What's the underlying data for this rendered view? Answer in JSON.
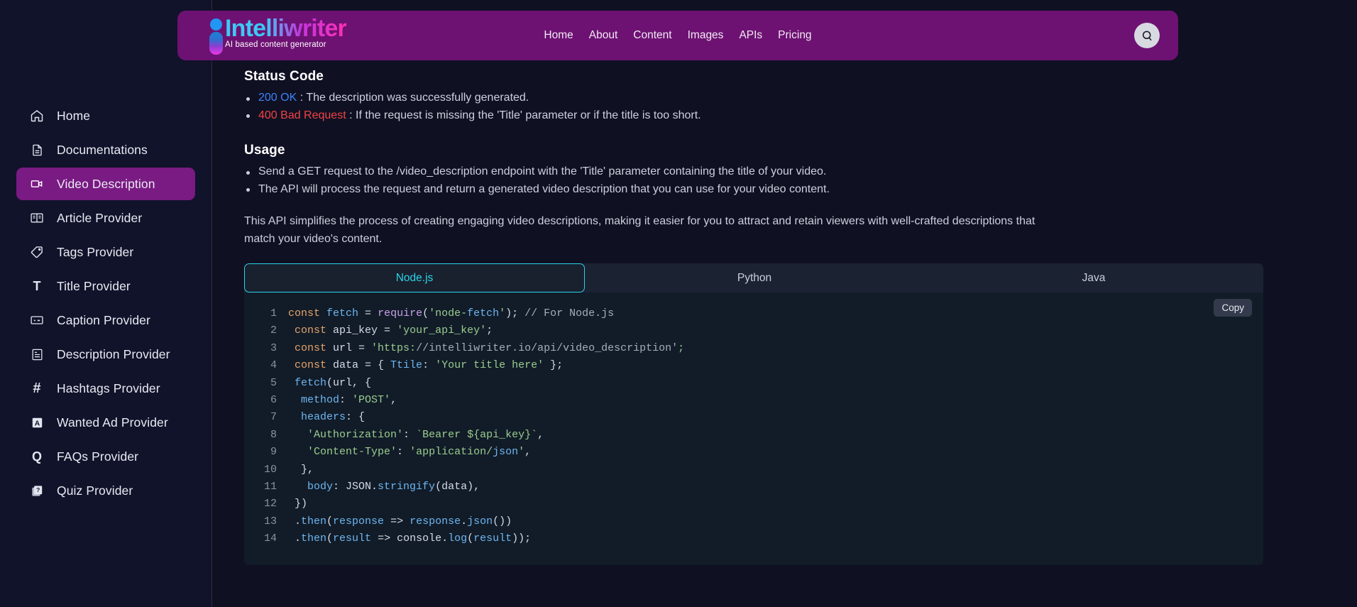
{
  "header": {
    "logo": {
      "word": "Intelliwriter",
      "tagline": "AI based content generator"
    },
    "nav": [
      "Home",
      "About",
      "Content",
      "Images",
      "APIs",
      "Pricing"
    ],
    "search_icon": "search-icon",
    "bg_color": "#6d1272"
  },
  "sidebar": {
    "items": [
      {
        "label": "Home",
        "icon": "home-icon",
        "active": false
      },
      {
        "label": "Documentations",
        "icon": "document-icon",
        "active": false
      },
      {
        "label": "Video Description",
        "icon": "video-icon",
        "active": true
      },
      {
        "label": "Article Provider",
        "icon": "book-icon",
        "active": false
      },
      {
        "label": "Tags Provider",
        "icon": "tag-icon",
        "active": false
      },
      {
        "label": "Title Provider",
        "icon": "text-t-icon",
        "active": false
      },
      {
        "label": "Caption Provider",
        "icon": "caption-icon",
        "active": false
      },
      {
        "label": "Description Provider",
        "icon": "description-icon",
        "active": false
      },
      {
        "label": "Hashtags Provider",
        "icon": "hashtag-icon",
        "active": false
      },
      {
        "label": "Wanted Ad Provider",
        "icon": "ad-icon",
        "active": false
      },
      {
        "label": "FAQs Provider",
        "icon": "question-q-icon",
        "active": false
      },
      {
        "label": "Quiz Provider",
        "icon": "quiz-icon",
        "active": false
      }
    ],
    "active_color": "#7a1a83"
  },
  "main": {
    "status_section": {
      "title": "Status Code",
      "items": [
        {
          "code": "200 OK",
          "color": "#3b82f6",
          "text": " : The description was successfully generated."
        },
        {
          "code": "400 Bad Request",
          "color": "#ef4444",
          "text": " : If the request is missing the 'Title' parameter or if the title is too short."
        }
      ]
    },
    "usage_section": {
      "title": "Usage",
      "items": [
        "Send a GET request to the /video_description endpoint with the 'Title' parameter containing the title of your video.",
        "The API will process the request and return a generated video description that you can use for your video content."
      ]
    },
    "paragraph": "This API simplifies the process of creating engaging video descriptions, making it easier for you to attract and retain viewers with well-crafted descriptions that match your video's content.",
    "tabs": [
      {
        "label": "Node.js",
        "active": true
      },
      {
        "label": "Python",
        "active": false
      },
      {
        "label": "Java",
        "active": false
      }
    ],
    "copy_label": "Copy",
    "code": {
      "language": "Node.js",
      "line_numbers": [
        1,
        2,
        3,
        4,
        5,
        6,
        7,
        8,
        9,
        10,
        11,
        12,
        13,
        14
      ],
      "lines": [
        "const fetch = require('node-fetch'); // For Node.js",
        " const api_key = 'your_api_key';",
        " const url = 'https://intelliwriter.io/api/video_description';",
        " const data = { Ttile: 'Your title here' };",
        " fetch(url, {",
        "  method: 'POST',",
        "  headers: {",
        "   'Authorization': `Bearer ${api_key}`,",
        "   'Content-Type': 'application/json',",
        "  },",
        "   body: JSON.stringify(data),",
        " })",
        " .then(response => response.json())",
        " .then(result => console.log(result));"
      ]
    }
  }
}
